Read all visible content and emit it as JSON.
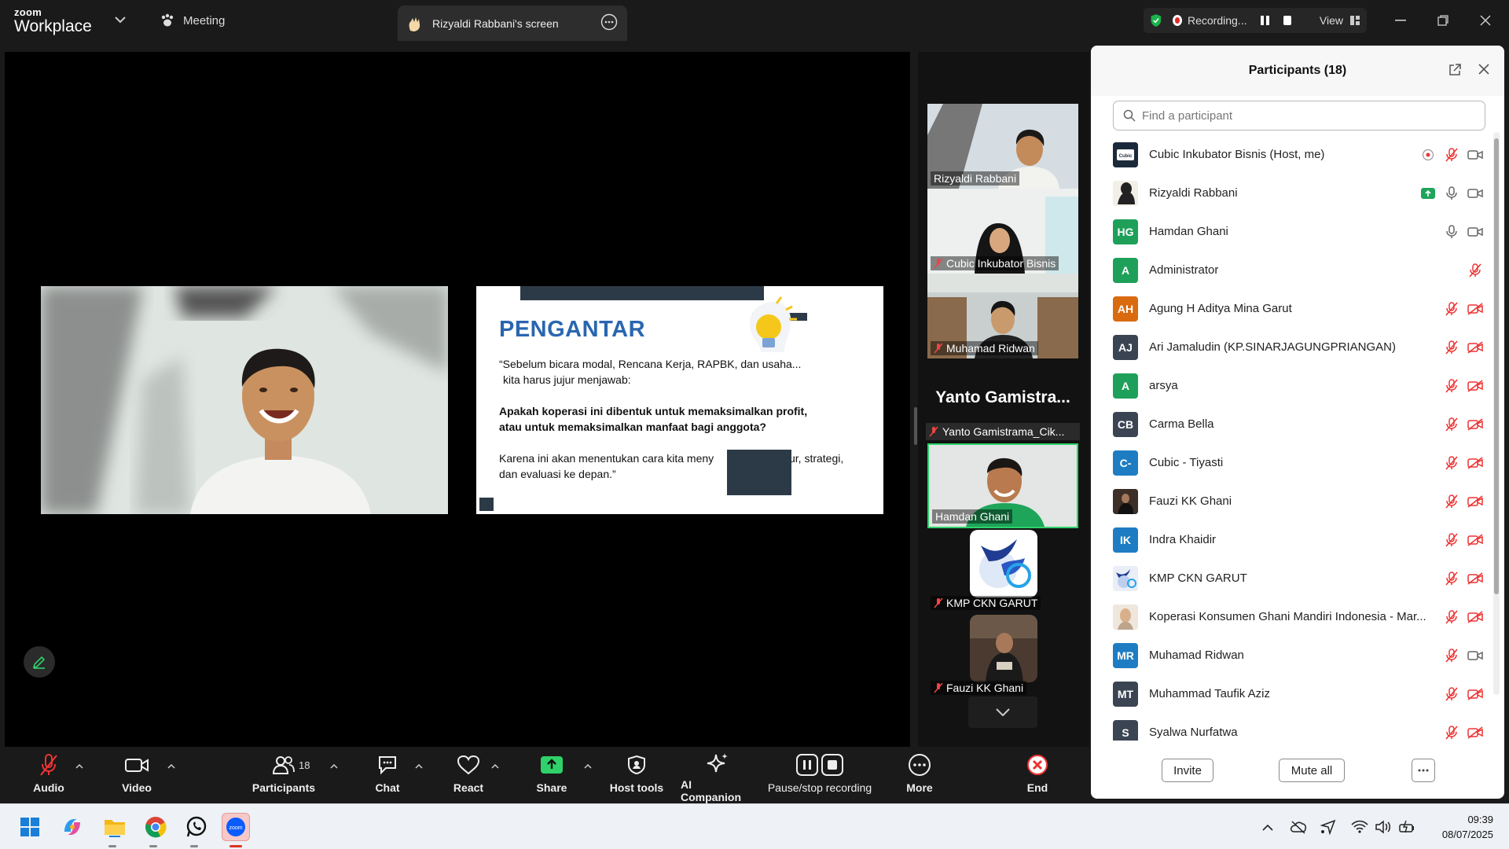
{
  "app": {
    "logo_top": "zoom",
    "logo_bottom": "Workplace",
    "meeting_label": "Meeting",
    "screen_tab": "Rizyaldi Rabbani's screen",
    "recording": "Recording...",
    "view": "View"
  },
  "slide": {
    "title": "PENGANTAR",
    "p1a": "“Sebelum bicara modal, Rencana Kerja, RAPBK, dan usaha...",
    "p1b": "kita harus jujur menjawab:",
    "q1": "Apakah koperasi ini dibentuk untuk memaksimalkan profit,",
    "q2": "atau untuk memaksimalkan manfaat bagi anggota?",
    "p3a": "Karena ini akan menentukan cara kita meny",
    "p3b": "ur, strategi,",
    "p3c": "dan evaluasi ke depan.”"
  },
  "filmstrip": {
    "t1": "Rizyaldi Rabbani",
    "t2": "Cubic Inkubator Bisnis",
    "t3": "Muhamad Ridwan",
    "big": "Yanto Gamistra...",
    "yanto": "Yanto Gamistrama_Cik...",
    "t4": "Hamdan Ghani",
    "t5": "KMP CKN GARUT",
    "t6": "Fauzi KK Ghani"
  },
  "panel": {
    "title": "Participants (18)",
    "search_placeholder": "Find a participant",
    "invite": "Invite",
    "mute_all": "Mute all",
    "participants": [
      {
        "name": "Cubic Inkubator Bisnis (Host, me)",
        "initials": "",
        "color": "#1b2a3a"
      },
      {
        "name": "Rizyaldi Rabbani",
        "initials": "",
        "color": "#f2efe7"
      },
      {
        "name": "Hamdan Ghani",
        "initials": "HG",
        "color": "#1fa05a"
      },
      {
        "name": "Administrator",
        "initials": "A",
        "color": "#1fa05a"
      },
      {
        "name": "Agung H Aditya Mina Garut",
        "initials": "AH",
        "color": "#d96a10"
      },
      {
        "name": "Ari Jamaludin (KP.SINARJAGUNGPRIANGAN)",
        "initials": "AJ",
        "color": "#3a4452"
      },
      {
        "name": "arsya",
        "initials": "A",
        "color": "#1fa05a"
      },
      {
        "name": "Carma Bella",
        "initials": "CB",
        "color": "#3a4452"
      },
      {
        "name": "Cubic - Tiyasti",
        "initials": "C-",
        "color": "#1e7dc2"
      },
      {
        "name": "Fauzi KK Ghani",
        "initials": "",
        "color": "#3b2f28"
      },
      {
        "name": "Indra Khaidir",
        "initials": "IK",
        "color": "#1e7dc2"
      },
      {
        "name": "KMP CKN GARUT",
        "initials": "",
        "color": "#e9eef7"
      },
      {
        "name": "Koperasi Konsumen Ghani Mandiri Indonesia - Mar...",
        "initials": "",
        "color": "#d9c9b8"
      },
      {
        "name": "Muhamad Ridwan",
        "initials": "MR",
        "color": "#1e7dc2"
      },
      {
        "name": "Muhammad Taufik Aziz",
        "initials": "MT",
        "color": "#3a4452"
      },
      {
        "name": "Syalwa Nurfatwa",
        "initials": "S",
        "color": "#3a4452"
      }
    ]
  },
  "toolbar": {
    "audio": "Audio",
    "video": "Video",
    "participants": "Participants",
    "participants_count": "18",
    "chat": "Chat",
    "react": "React",
    "share": "Share",
    "host_tools": "Host tools",
    "ai": "AI Companion",
    "pause": "Pause/stop recording",
    "more": "More",
    "end": "End"
  },
  "taskbar": {
    "time": "09:39",
    "date": "08/07/2025"
  }
}
